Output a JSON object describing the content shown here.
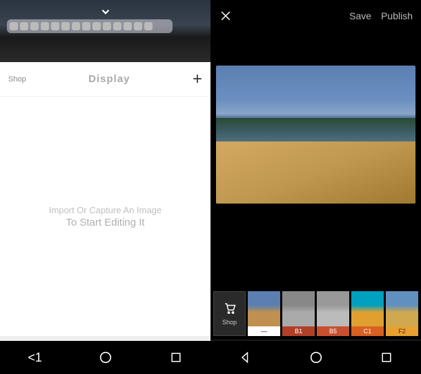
{
  "left": {
    "header": {
      "shop": "Shop",
      "title": "Display",
      "add": "+"
    },
    "prompt": {
      "line1": "Import Or Capture An Image",
      "line2": "To Start Editing It"
    },
    "nav_back_label": "<1"
  },
  "right": {
    "close": "✕",
    "save": "Save",
    "publish": "Publish",
    "filters": {
      "shop_label": "Shop",
      "items": [
        {
          "label": "—"
        },
        {
          "label": "B1"
        },
        {
          "label": "B5"
        },
        {
          "label": "C1"
        },
        {
          "label": "F2"
        }
      ]
    }
  },
  "icons": {
    "chevron_down": "⌄",
    "circle_lines": "◍",
    "camera_square": "⊡",
    "smiley": "☺",
    "cart": "🛒",
    "preset_wheel": "❂",
    "sliders": "⚙",
    "undo": "↶",
    "redo": "↷"
  },
  "colors": {
    "left_bg": "#ffffff",
    "left_bottom": "#efefef",
    "right_bg": "#000000",
    "filter_b1": "#b04028",
    "filter_b5": "#c85030",
    "filter_c1": "#d86020",
    "filter_f2": "#e8a030"
  }
}
